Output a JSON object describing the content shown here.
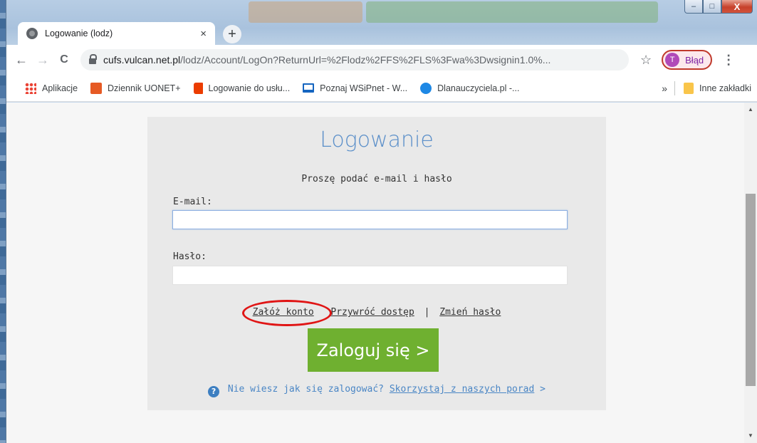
{
  "window": {
    "min_label": "–",
    "max_label": "□",
    "close_label": "X"
  },
  "tab": {
    "title": "Logowanie (lodz)",
    "close": "×",
    "new_tab": "+"
  },
  "toolbar": {
    "back": "←",
    "forward": "→",
    "reload": "C",
    "url_host": "cufs.vulcan.net.pl",
    "url_rest": "/lodz/Account/LogOn?ReturnUrl=%2Flodz%2FFS%2FLS%3Fwa%3Dwsignin1.0%...",
    "star": "☆",
    "profile_initial": "T",
    "profile_label": "Błąd",
    "menu": "⋮"
  },
  "bookmarks": {
    "items": [
      {
        "label": "Aplikacje",
        "icon": "apps-grid-icon"
      },
      {
        "label": "Dziennik UONET+",
        "icon": "uonet-icon"
      },
      {
        "label": "Logowanie do usłu...",
        "icon": "office-icon"
      },
      {
        "label": "Poznaj WSiPnet - W...",
        "icon": "monitor-icon"
      },
      {
        "label": "Dlanauczyciela.pl -...",
        "icon": "blue-circle-icon"
      }
    ],
    "overflow": "»",
    "other": "Inne zakładki"
  },
  "page": {
    "heading": "Logowanie",
    "subtitle": "Proszę podać e-mail i hasło",
    "email_label": "E-mail:",
    "email_value": "",
    "password_label": "Hasło:",
    "password_value": "",
    "link_register": "Załóż konto",
    "link_restore": "Przywróć dostęp",
    "link_sep": "|",
    "link_change": "Zmień hasło",
    "login_button": "Zaloguj się >",
    "help_question": "?",
    "help_text": "Nie wiesz jak się zalogować?",
    "help_link": "Skorzystaj z naszych porad",
    "help_arrow": ">"
  },
  "colors": {
    "heading": "#5b8fc9",
    "login_button": "#6fb030",
    "annotation_circle": "#e01515",
    "panel": "#e9e9e9"
  }
}
